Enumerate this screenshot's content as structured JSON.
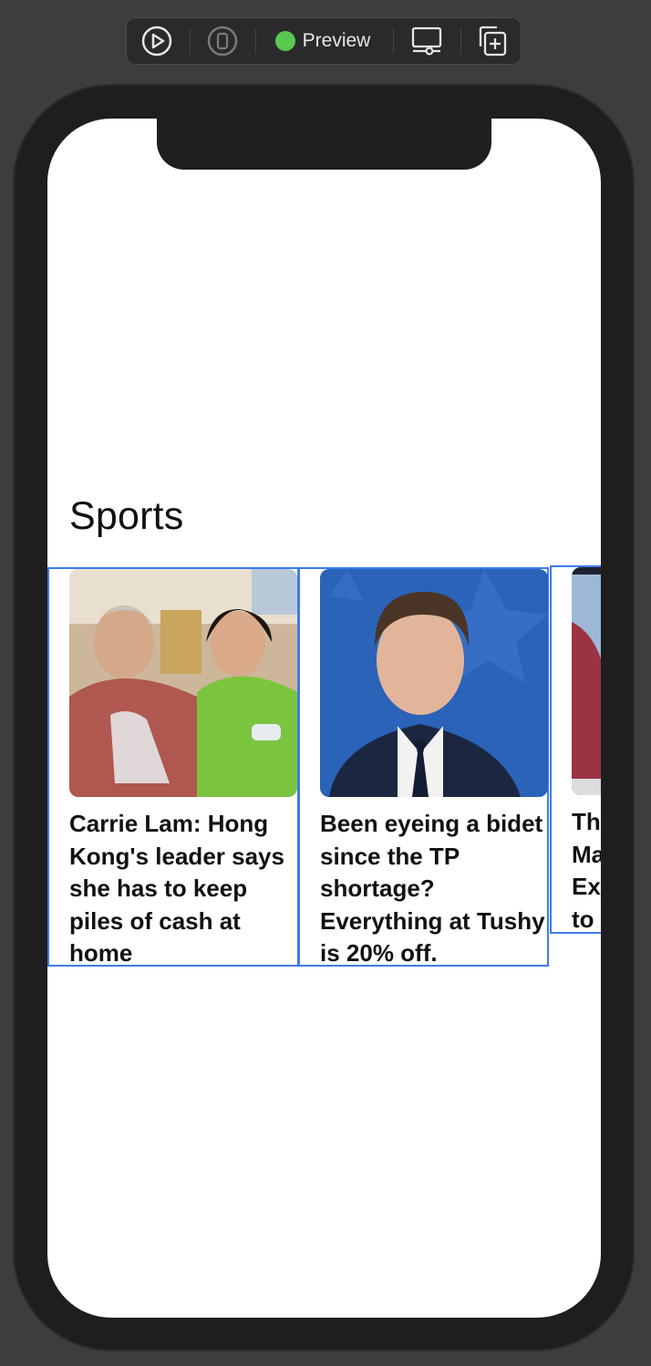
{
  "toolbar": {
    "play_icon": "play-icon",
    "device_icon": "device-icon",
    "preview_label": "Preview",
    "preview_status_color": "#5ac750",
    "display_icon": "display-settings-icon",
    "duplicate_icon": "duplicate-add-icon"
  },
  "screen": {
    "section_title": "Sports",
    "cards": [
      {
        "title": "Carrie Lam: Hong Kong's leader says she has to keep piles of cash at home",
        "image": "two women smiling photo"
      },
      {
        "title": "Been eyeing a bidet since the TP shortage? Everything at Tushy is 20% off.",
        "image": "man in suit portrait photo"
      },
      {
        "title": "Th Ma Ex to",
        "image": "partially visible photo"
      }
    ]
  },
  "colors": {
    "selection_outline": "#3d7bea",
    "background": "#3d3d3d"
  }
}
